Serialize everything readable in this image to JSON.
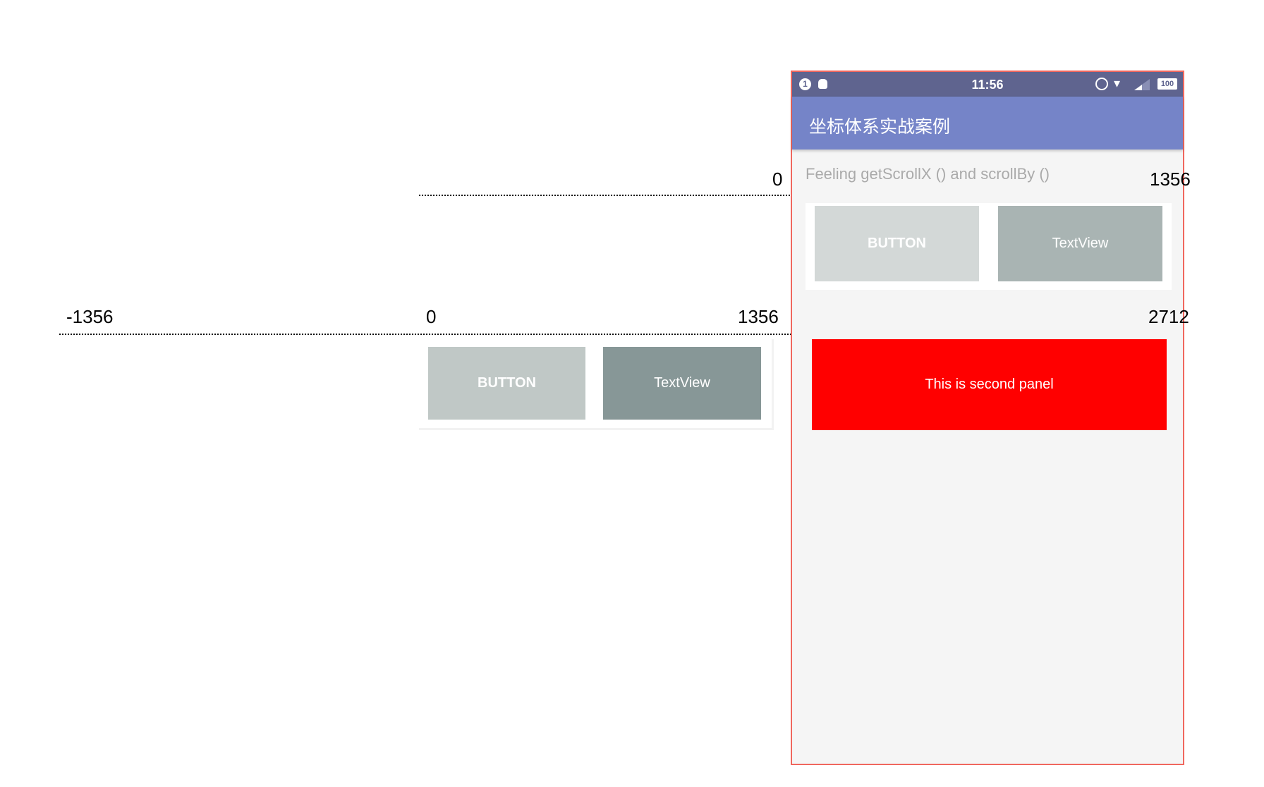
{
  "phone": {
    "status_bar": {
      "time": "11:56",
      "notification_badge": "1",
      "battery": "100",
      "icons": [
        "notification-badge-icon",
        "android-icon",
        "alarm-icon",
        "wifi-icon",
        "signal-icon",
        "battery-icon"
      ]
    },
    "app_title": "坐标体系实战案例",
    "subtitle": "Feeling getScrollX () and scrollBy ()",
    "button_label": "BUTTON",
    "textview_label": "TextView",
    "second_panel_label": "This is second panel"
  },
  "outside_panel": {
    "button_label": "BUTTON",
    "textview_label": "TextView"
  },
  "axis_top": {
    "labels": [
      "0",
      "1356"
    ]
  },
  "axis_bottom": {
    "labels": [
      "-1356",
      "0",
      "1356",
      "2712"
    ]
  },
  "colors": {
    "frame": "#f0675e",
    "status_bar": "#5f648f",
    "app_bar": "#7584c8",
    "second_panel": "#ff0000"
  }
}
